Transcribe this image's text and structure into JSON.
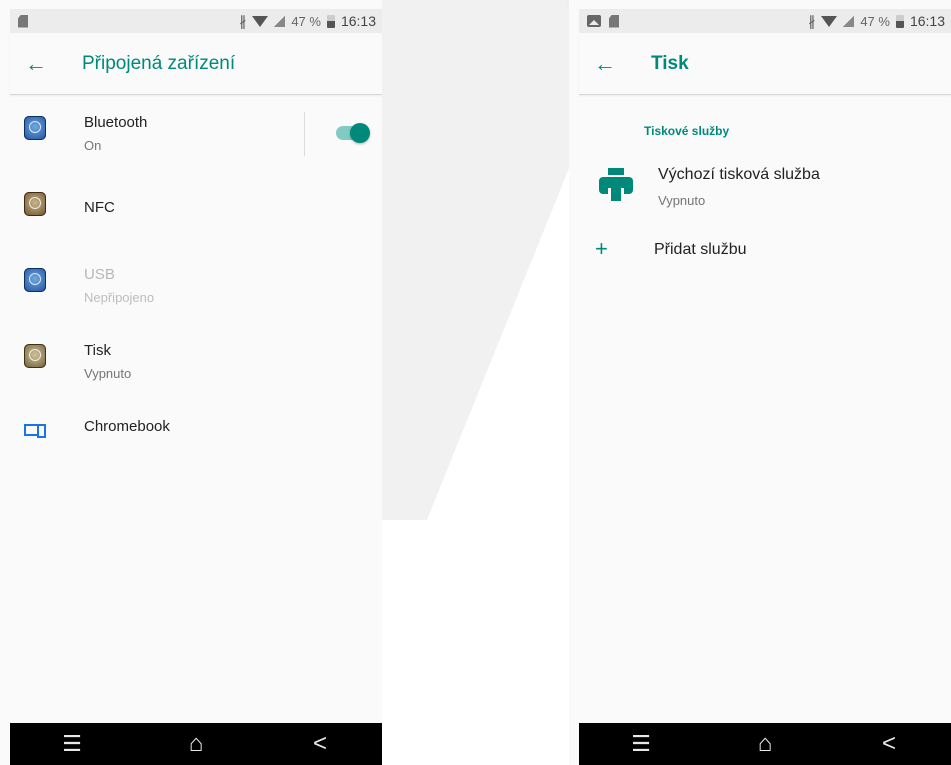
{
  "status_bar": {
    "battery_percent": "47 %",
    "time": "16:13"
  },
  "left_screen": {
    "title": "Připojená zařízení",
    "items": [
      {
        "title": "Bluetooth",
        "subtitle": "On",
        "icon": "bluetooth-icon",
        "toggle_on": true
      },
      {
        "title": "NFC",
        "subtitle": "",
        "icon": "nfc-icon"
      },
      {
        "title": "USB",
        "subtitle": "Nepřipojeno",
        "icon": "usb-icon",
        "disabled": true
      },
      {
        "title": "Tisk",
        "subtitle": "Vypnuto",
        "icon": "print-icon"
      },
      {
        "title": "Chromebook",
        "subtitle": "",
        "icon": "chromebook-icon"
      }
    ]
  },
  "right_screen": {
    "title": "Tisk",
    "section_header": "Tiskové služby",
    "service": {
      "title": "Výchozí tisková služba",
      "subtitle": "Vypnuto",
      "icon": "printer-icon"
    },
    "add_service_label": "Přidat službu"
  },
  "nav_bar": {
    "menu_glyph": "☰",
    "home_glyph": "⌂",
    "back_glyph": "<"
  },
  "colors": {
    "accent": "#00897b",
    "accent_light": "#80cbc4",
    "nav_background": "#000000"
  }
}
